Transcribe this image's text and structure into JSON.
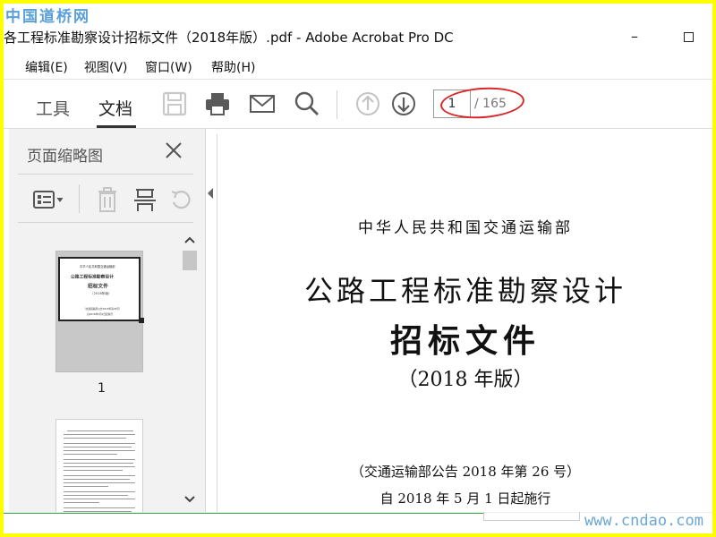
{
  "watermark": {
    "site_cn": "中国道桥网",
    "site_url": "www.cndao.com"
  },
  "window": {
    "title": "各工程标准勘察设计招标文件（2018年版）.pdf - Adobe Acrobat Pro DC",
    "minimize": "–"
  },
  "menu": {
    "items": [
      "编辑(E)",
      "视图(V)",
      "窗口(W)",
      "帮助(H)"
    ]
  },
  "toolbar": {
    "tab_tools": "工具",
    "tab_document": "文档",
    "current_page": "1",
    "total_pages": "/ 165"
  },
  "sidebar": {
    "title": "页面缩略图",
    "thumbnails": [
      {
        "label": "1",
        "lines": [
          "中华人民共和国交通运输部",
          "公路工程标准勘察设计",
          "招标文件",
          "（2018年版）",
          "（交通运输部公告2018年第26号）",
          "自2018年5月1日起施行"
        ]
      },
      {
        "label": ""
      }
    ]
  },
  "document": {
    "org": "中华人民共和国交通运输部",
    "title_line1": "公路工程标准勘察设计",
    "title_line2": "招标文件",
    "edition": "（2018 年版）",
    "announcement": "（交通运输部公告 2018 年第 26 号）",
    "effective": "自 2018 年 5 月 1 日起施行"
  },
  "colors": {
    "highlight": "#d8262a",
    "frame": "#ffff00"
  }
}
